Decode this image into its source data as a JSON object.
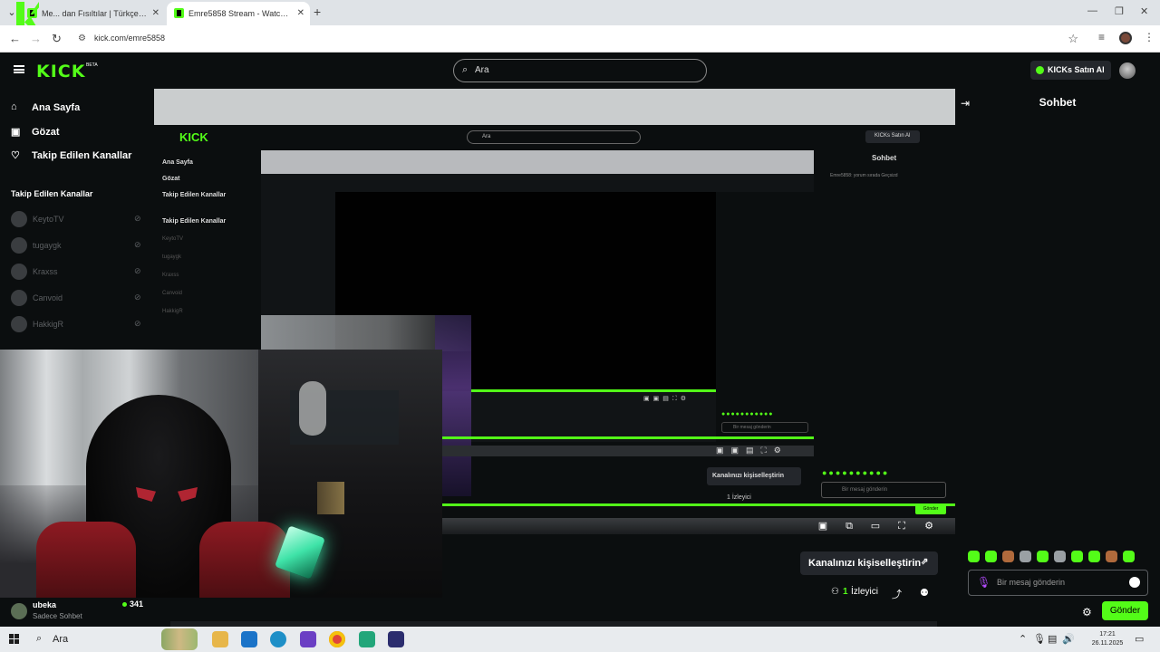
{
  "browser": {
    "tabs": [
      {
        "title": "Me... dan Fısıltılar | Türkçe Dub..."
      },
      {
        "title": "Emre5858 Stream - Watch Live"
      }
    ],
    "url": "kick.com/emre5858"
  },
  "header": {
    "logo": "KICK",
    "beta": "BETA",
    "search_placeholder": "Ara",
    "buy_label": "KICKs Satın Al"
  },
  "sidebar": {
    "nav": [
      {
        "label": "Ana Sayfa",
        "icon": "home-icon"
      },
      {
        "label": "Gözat",
        "icon": "browse-icon"
      },
      {
        "label": "Takip Edilen Kanallar",
        "icon": "heart-icon"
      }
    ],
    "followed_heading": "Takip Edilen Kanallar",
    "channels": [
      {
        "name": "KeytoTV"
      },
      {
        "name": "tugaygk"
      },
      {
        "name": "Kraxss"
      },
      {
        "name": "Canvoid"
      },
      {
        "name": "HakkigR"
      }
    ]
  },
  "stream": {
    "nested": {
      "search": "Ara",
      "buy": "KICKs Satın Al",
      "nav": [
        "Ana Sayfa",
        "Gözat",
        "Takip Edilen Kanallar"
      ],
      "followed_heading": "Takip Edilen Kanallar",
      "channels": [
        "KeytoTV",
        "tugaygk",
        "Kraxss",
        "Canvoid",
        "HakkigR"
      ],
      "chat_title": "Sohbet",
      "chat_line": "Emre5858: yorum sırada Geçsizd",
      "customize": "Kanalınızı kişiselleştirin",
      "viewers": "1 İzleyici",
      "message_placeholder": "Bir mesaj gönderin",
      "send": "Gönder"
    }
  },
  "chat": {
    "title": "Sohbet",
    "message_placeholder": "Bir mesaj gönderin",
    "send_label": "Gönder"
  },
  "channel_info": {
    "customize_label": "Kanalınızı kişiselleştirin",
    "viewer_count": "1",
    "viewer_label": "İzleyici"
  },
  "streamer": {
    "name": "ubeka",
    "subtitle": "Sadece Sohbet",
    "count": "341"
  },
  "taskbar": {
    "search_label": "Ara",
    "time": "17:21",
    "date": "26.11.2025"
  },
  "colors": {
    "brand": "#53fc18",
    "background": "#0b0e0f",
    "panel": "#24272c"
  }
}
